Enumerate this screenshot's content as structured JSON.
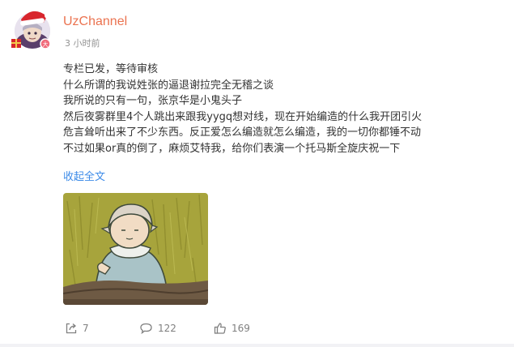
{
  "post": {
    "author": "UzChannel",
    "time": "3 小时前",
    "lines": [
      "专栏已发，等待审核",
      "什么所谓的我说姓张的逼退谢拉完全无稽之谈",
      "我所说的只有一句，张京华是小鬼头子",
      "然后夜雾群里4个人跳出来跟我yygq想对线，现在开始编造的什么我开团引火",
      "危言耸听出来了不少东西。反正爱怎么编造就怎么编造，我的一切你都锤不动",
      "不过如果or真的倒了，麻烦艾特我，给你们表演一个托马斯全旋庆祝一下"
    ],
    "collapse_label": "收起全文"
  },
  "actions": {
    "repost_icon": "share-icon",
    "repost_count": "7",
    "comment_icon": "comment-icon",
    "comment_count": "122",
    "like_icon": "thumbs-up-icon",
    "like_count": "169"
  },
  "colors": {
    "author": "#eb7350",
    "link": "#3d8be8",
    "meta": "#939393"
  }
}
